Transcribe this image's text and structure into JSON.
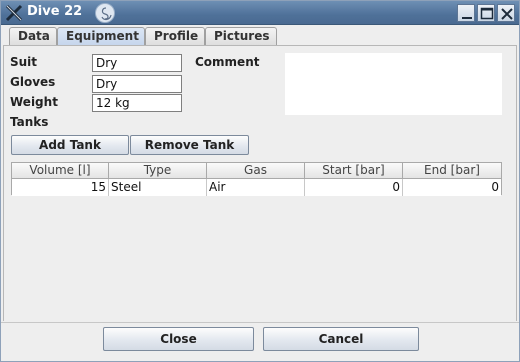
{
  "window": {
    "title": "Dive 22"
  },
  "tabs": [
    {
      "label": "Data",
      "active": false
    },
    {
      "label": "Equipment",
      "active": true
    },
    {
      "label": "Profile",
      "active": false
    },
    {
      "label": "Pictures",
      "active": false
    }
  ],
  "form": {
    "suit_label": "Suit",
    "suit_value": "Dry",
    "gloves_label": "Gloves",
    "gloves_value": "Dry",
    "weight_label": "Weight",
    "weight_value": "12 kg",
    "comment_label": "Comment",
    "comment_value": "",
    "tanks_label": "Tanks"
  },
  "tank_buttons": {
    "add": "Add Tank",
    "remove": "Remove Tank"
  },
  "table": {
    "columns": [
      "Volume [l]",
      "Type",
      "Gas",
      "Start [bar]",
      "End [bar]"
    ],
    "rows": [
      [
        "15",
        "Steel",
        "Air",
        "0",
        "0"
      ]
    ]
  },
  "footer": {
    "close": "Close",
    "cancel": "Cancel"
  },
  "colors": {
    "titlebar": "#4f7199",
    "active_tab": "#c6d6ec",
    "background": "#eeeeee"
  },
  "icons": [
    "x-logo-icon",
    "swirl-icon",
    "minimize-icon",
    "maximize-icon",
    "close-icon"
  ]
}
